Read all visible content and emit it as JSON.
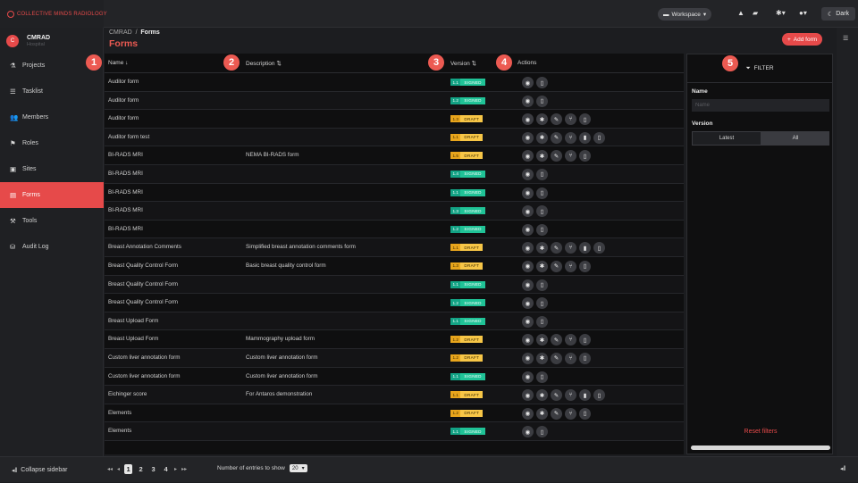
{
  "topbar": {
    "brand": "COLLECTIVE MINDS RADIOLOGY",
    "workspace_label": "Workspace",
    "dark_label": "Dark"
  },
  "user": {
    "initial": "C",
    "name": "CMRAD",
    "sub": "Hospital"
  },
  "sidebar": {
    "items": [
      {
        "label": "Projects",
        "icon": "flask-icon",
        "glyph": "⚗"
      },
      {
        "label": "Tasklist",
        "icon": "list-icon",
        "glyph": "☰"
      },
      {
        "label": "Members",
        "icon": "users-icon",
        "glyph": "👥"
      },
      {
        "label": "Roles",
        "icon": "roles-icon",
        "glyph": "⚑"
      },
      {
        "label": "Sites",
        "icon": "building-icon",
        "glyph": "▣"
      },
      {
        "label": "Forms",
        "icon": "form-icon",
        "glyph": "▤",
        "active": true
      },
      {
        "label": "Tools",
        "icon": "tools-icon",
        "glyph": "⚒"
      },
      {
        "label": "Audit Log",
        "icon": "audit-icon",
        "glyph": "⛁"
      }
    ],
    "collapse_label": "Collapse sidebar"
  },
  "header": {
    "breadcrumb_root": "CMRAD",
    "breadcrumb_sep": "/",
    "breadcrumb_current": "Forms",
    "title": "Forms",
    "add_label": "Add form"
  },
  "table": {
    "columns": {
      "name": "Name",
      "description": "Description",
      "version": "Version",
      "actions": "Actions"
    },
    "rows": [
      {
        "name": "Auditor form",
        "description": "",
        "ver": "1.1",
        "status": "SIGNED",
        "actions": [
          "eye",
          "doc"
        ]
      },
      {
        "name": "Auditor form",
        "description": "",
        "ver": "1.2",
        "status": "SIGNED",
        "actions": [
          "eye",
          "doc"
        ]
      },
      {
        "name": "Auditor form",
        "description": "",
        "ver": "1.3",
        "status": "DRAFT",
        "actions": [
          "eye",
          "gear",
          "pen",
          "fork",
          "doc"
        ]
      },
      {
        "name": "Auditor form test",
        "description": "",
        "ver": "1.1",
        "status": "DRAFT",
        "actions": [
          "eye",
          "gear",
          "pen",
          "fork",
          "trash",
          "doc"
        ]
      },
      {
        "name": "BI-RADS MRI",
        "description": "NEMA BI-RADS form",
        "ver": "1.5",
        "status": "DRAFT",
        "actions": [
          "eye",
          "gear",
          "pen",
          "fork",
          "doc"
        ]
      },
      {
        "name": "BI-RADS MRI",
        "description": "",
        "ver": "1.4",
        "status": "SIGNED",
        "actions": [
          "eye",
          "doc"
        ]
      },
      {
        "name": "BI-RADS MRI",
        "description": "",
        "ver": "1.1",
        "status": "SIGNED",
        "actions": [
          "eye",
          "doc"
        ]
      },
      {
        "name": "BI-RADS MRI",
        "description": "",
        "ver": "1.3",
        "status": "SIGNED",
        "actions": [
          "eye",
          "doc"
        ]
      },
      {
        "name": "BI-RADS MRI",
        "description": "",
        "ver": "1.2",
        "status": "SIGNED",
        "actions": [
          "eye",
          "doc"
        ]
      },
      {
        "name": "Breast Annotation Comments",
        "description": "Simplified breast annotation comments form",
        "ver": "1.1",
        "status": "DRAFT",
        "actions": [
          "eye",
          "gear",
          "pen",
          "fork",
          "trash",
          "doc"
        ]
      },
      {
        "name": "Breast Quality Control Form",
        "description": "Basic breast quality control form",
        "ver": "1.3",
        "status": "DRAFT",
        "actions": [
          "eye",
          "gear",
          "pen",
          "fork",
          "doc"
        ]
      },
      {
        "name": "Breast Quality Control Form",
        "description": "",
        "ver": "1.1",
        "status": "SIGNED",
        "actions": [
          "eye",
          "doc"
        ]
      },
      {
        "name": "Breast Quality Control Form",
        "description": "",
        "ver": "1.2",
        "status": "SIGNED",
        "actions": [
          "eye",
          "doc"
        ]
      },
      {
        "name": "Breast Upload Form",
        "description": "",
        "ver": "1.1",
        "status": "SIGNED",
        "actions": [
          "eye",
          "doc"
        ]
      },
      {
        "name": "Breast Upload Form",
        "description": "Mammography upload form",
        "ver": "1.2",
        "status": "DRAFT",
        "actions": [
          "eye",
          "gear",
          "pen",
          "fork",
          "doc"
        ]
      },
      {
        "name": "Custom liver annotation form",
        "description": "Custom liver annotation form",
        "ver": "1.2",
        "status": "DRAFT",
        "actions": [
          "eye",
          "gear",
          "pen",
          "fork",
          "doc"
        ]
      },
      {
        "name": "Custom liver annotation form",
        "description": "Custom liver annotation form",
        "ver": "1.1",
        "status": "SIGNED",
        "actions": [
          "eye",
          "doc"
        ]
      },
      {
        "name": "Eichinger score",
        "description": "For Antaros demonstration",
        "ver": "1.1",
        "status": "DRAFT",
        "actions": [
          "eye",
          "gear",
          "pen",
          "fork",
          "trash",
          "doc"
        ]
      },
      {
        "name": "Elements",
        "description": "",
        "ver": "1.2",
        "status": "DRAFT",
        "actions": [
          "eye",
          "gear",
          "pen",
          "fork",
          "doc"
        ]
      },
      {
        "name": "Elements",
        "description": "",
        "ver": "1.1",
        "status": "SIGNED",
        "actions": [
          "eye",
          "doc"
        ]
      }
    ]
  },
  "filter": {
    "title": "FILTER",
    "name_label": "Name",
    "name_placeholder": "Name",
    "version_label": "Version",
    "opt_latest": "Latest",
    "opt_all": "All",
    "reset_label": "Reset filters"
  },
  "pagination": {
    "pages": [
      "1",
      "2",
      "3",
      "4"
    ],
    "current": "1",
    "entries_label": "Number of entries to show",
    "entries_value": "20"
  },
  "markers": [
    "1",
    "2",
    "3",
    "4",
    "5"
  ],
  "colors": {
    "accent": "#e64a4a",
    "signed": "#20c397",
    "draft": "#f7c647"
  }
}
